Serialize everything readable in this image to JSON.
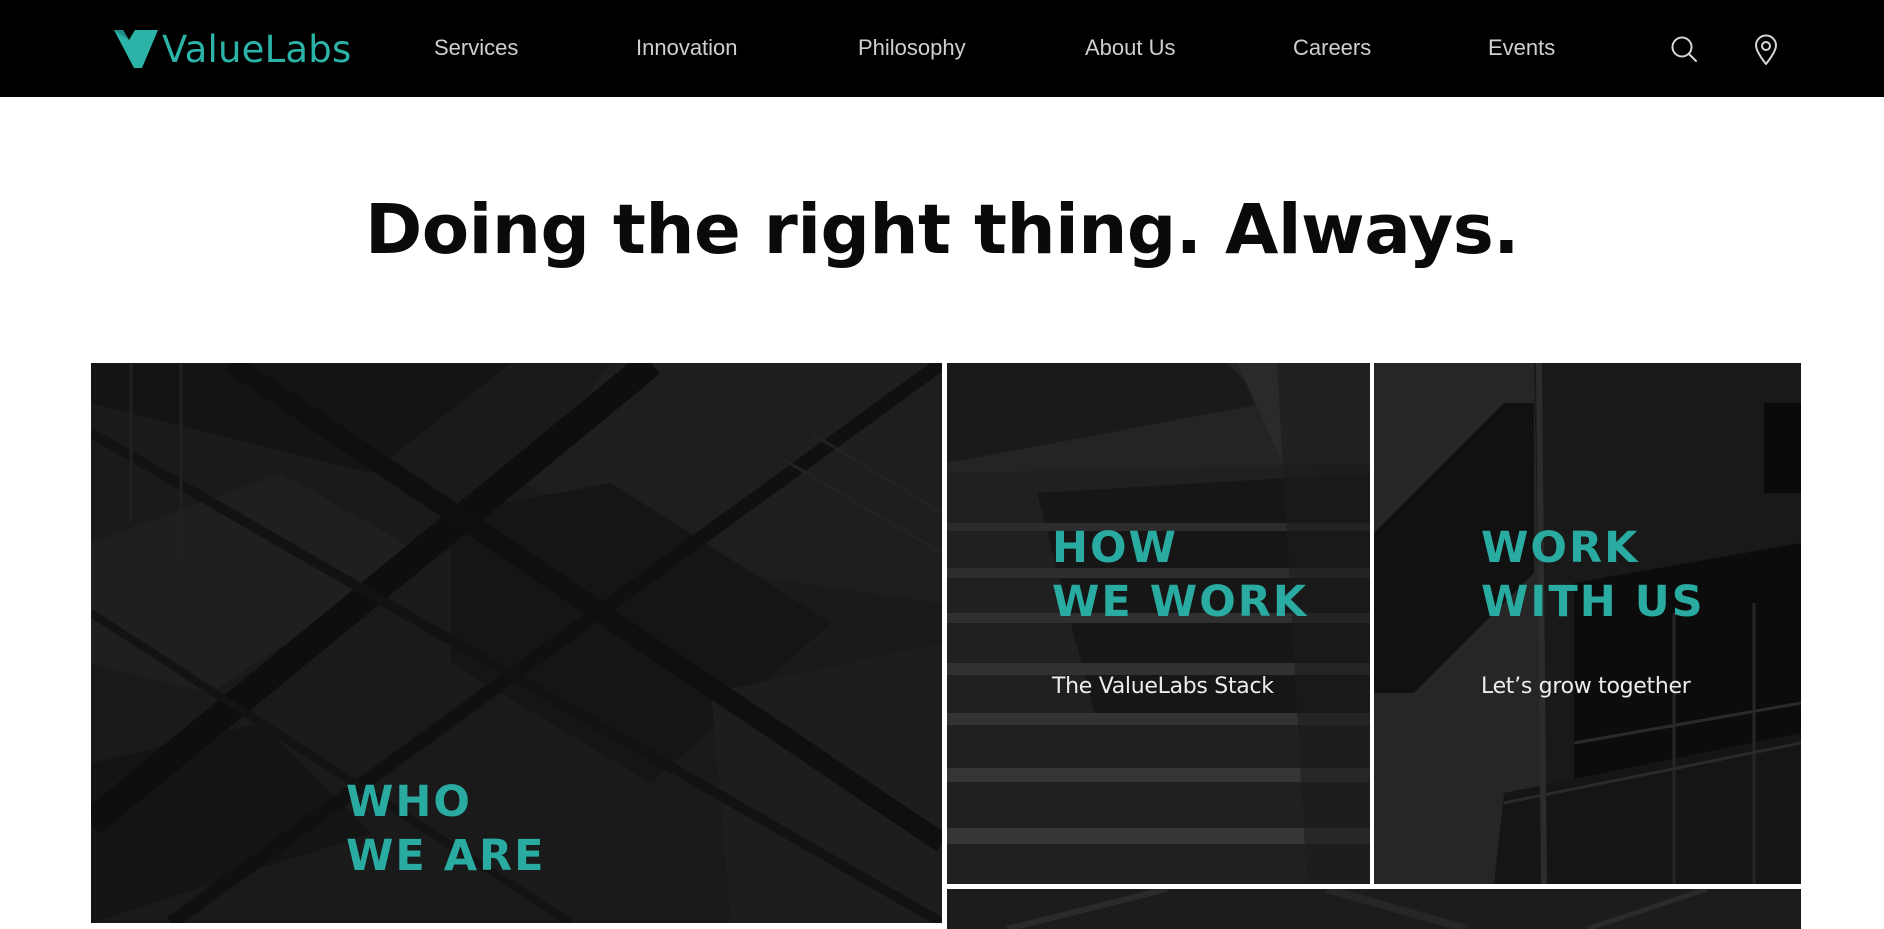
{
  "header": {
    "brand": "ValueLabs",
    "brand_color": "#2bb3a8",
    "nav": [
      {
        "label": "Services"
      },
      {
        "label": "Innovation"
      },
      {
        "label": "Philosophy"
      },
      {
        "label": "About Us"
      },
      {
        "label": "Careers"
      },
      {
        "label": "Events"
      }
    ],
    "icons": [
      "search-icon",
      "location-pin-icon"
    ]
  },
  "hero": {
    "headline": "Doing the right thing. Always."
  },
  "tiles": {
    "who_we_are": {
      "title_line1": "WHO",
      "title_line2": "WE ARE"
    },
    "how_we_work": {
      "title_line1": "HOW",
      "title_line2": "WE WORK",
      "subtitle": "The ValueLabs Stack"
    },
    "work_with_us": {
      "title_line1": "WORK",
      "title_line2": "WITH US",
      "subtitle": "Let’s grow together"
    }
  },
  "colors": {
    "accent": "#2aaba2",
    "topbar": "#000000",
    "tile_background": "#161616"
  }
}
